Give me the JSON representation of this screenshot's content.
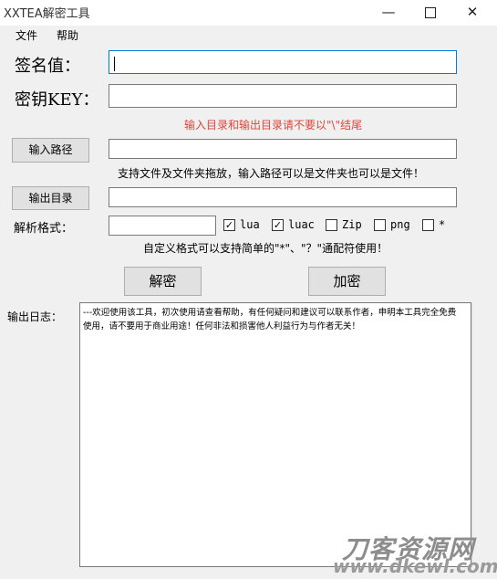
{
  "window": {
    "title": "XXTEA解密工具",
    "minimize_glyph": "—",
    "close_glyph": "✕"
  },
  "menu": {
    "items": [
      {
        "label": "文件"
      },
      {
        "label": "帮助"
      }
    ]
  },
  "form": {
    "signature_label": "签名值：",
    "signature_value": "",
    "key_label": "密钥KEY：",
    "key_value": "",
    "warning": "输入目录和输出目录请不要以\"\\\"结尾",
    "input_path_button": "输入路径",
    "input_path_value": "",
    "input_hint": "支持文件及文件夹拖放，输入路径可以是文件夹也可以是文件！",
    "output_dir_button": "输出目录",
    "output_dir_value": "",
    "format_label": "解析格式：",
    "format_value": "",
    "formats": [
      {
        "label": "lua",
        "checked": true
      },
      {
        "label": "luac",
        "checked": true
      },
      {
        "label": "Zip",
        "checked": false
      },
      {
        "label": "png",
        "checked": false
      },
      {
        "label": "*",
        "checked": false
      }
    ],
    "format_hint": "自定义格式可以支持简单的\"*\"、\"？\"通配符使用！",
    "decrypt_button": "解密",
    "encrypt_button": "加密"
  },
  "log": {
    "label": "输出日志：",
    "text": "---欢迎使用该工具，初次使用请查看帮助，有任何疑问和建议可以联系作者，申明本工具完全免费使用，请不要用于商业用途！任何非法和损害他人利益行为与作者无关！"
  },
  "watermark": {
    "line1": "刀客资源网",
    "line2": "www.dkewl.com"
  },
  "colors": {
    "accent_focus": "#0078d7",
    "warning_text": "#e0463a"
  }
}
